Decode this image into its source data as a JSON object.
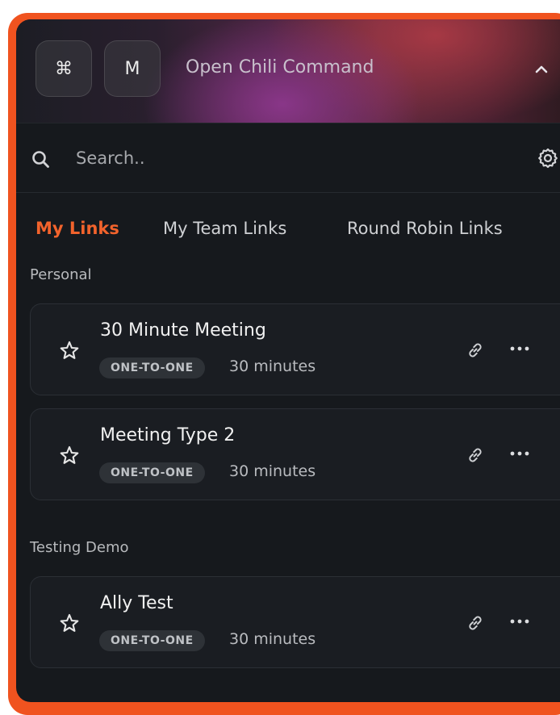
{
  "header": {
    "keys": [
      "⌘",
      "M"
    ],
    "command_label": "Open Chili Command",
    "chevron_icon": "chevron-up-icon"
  },
  "search": {
    "placeholder": "Search..",
    "value": "",
    "icon": "search-icon",
    "settings_icon": "gear-icon"
  },
  "tabs": [
    {
      "label": "My Links",
      "active": true
    },
    {
      "label": "My Team Links",
      "active": false
    },
    {
      "label": "Round Robin Links",
      "active": false
    }
  ],
  "sections": [
    {
      "label": "Personal",
      "items": [
        {
          "title": "30 Minute Meeting",
          "badge": "ONE-TO-ONE",
          "duration": "30 minutes"
        },
        {
          "title": "Meeting Type 2",
          "badge": "ONE-TO-ONE",
          "duration": "30 minutes"
        }
      ]
    },
    {
      "label": "Testing Demo",
      "items": [
        {
          "title": "Ally Test",
          "badge": "ONE-TO-ONE",
          "duration": "30 minutes"
        }
      ]
    }
  ],
  "colors": {
    "accent": "#f2632c",
    "frame": "#f0531f",
    "panel_bg": "#16191d",
    "card_bg": "#1a1d22"
  }
}
